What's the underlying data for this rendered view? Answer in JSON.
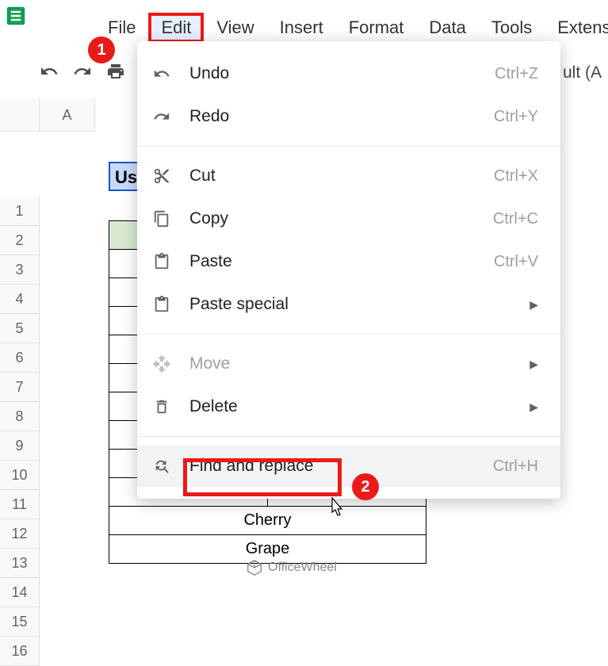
{
  "app": {
    "logo_color": "#0f9d58"
  },
  "menubar": {
    "items": [
      {
        "label": "File"
      },
      {
        "label": "Edit",
        "highlighted": true
      },
      {
        "label": "View"
      },
      {
        "label": "Insert"
      },
      {
        "label": "Format"
      },
      {
        "label": "Data"
      },
      {
        "label": "Tools"
      },
      {
        "label": "Extensio"
      }
    ]
  },
  "toolbar": {
    "right_label": "ult (A"
  },
  "callouts": {
    "one": "1",
    "two": "2"
  },
  "grid": {
    "col_a": "A",
    "rows": [
      "1",
      "2",
      "3",
      "4",
      "5",
      "6",
      "7",
      "8",
      "9",
      "10",
      "11",
      "12",
      "13",
      "14",
      "15",
      "16"
    ],
    "cell_b2": "Us",
    "data_cells": {
      "r14": "Cherry",
      "r15": "Grape"
    }
  },
  "edit_menu": {
    "items": [
      {
        "icon": "undo",
        "label": "Undo",
        "shortcut": "Ctrl+Z"
      },
      {
        "icon": "redo",
        "label": "Redo",
        "shortcut": "Ctrl+Y"
      },
      {
        "divider": true
      },
      {
        "icon": "cut",
        "label": "Cut",
        "shortcut": "Ctrl+X"
      },
      {
        "icon": "copy",
        "label": "Copy",
        "shortcut": "Ctrl+C"
      },
      {
        "icon": "paste",
        "label": "Paste",
        "shortcut": "Ctrl+V"
      },
      {
        "icon": "paste",
        "label": "Paste special",
        "submenu": true
      },
      {
        "divider": true
      },
      {
        "icon": "move",
        "label": "Move",
        "submenu": true,
        "disabled": true
      },
      {
        "icon": "delete",
        "label": "Delete",
        "submenu": true
      },
      {
        "divider": true
      },
      {
        "icon": "findreplace",
        "label": "Find and replace",
        "shortcut": "Ctrl+H",
        "hovered": true,
        "highlighted": true
      }
    ]
  },
  "watermark": {
    "text": "OfficeWheel"
  }
}
